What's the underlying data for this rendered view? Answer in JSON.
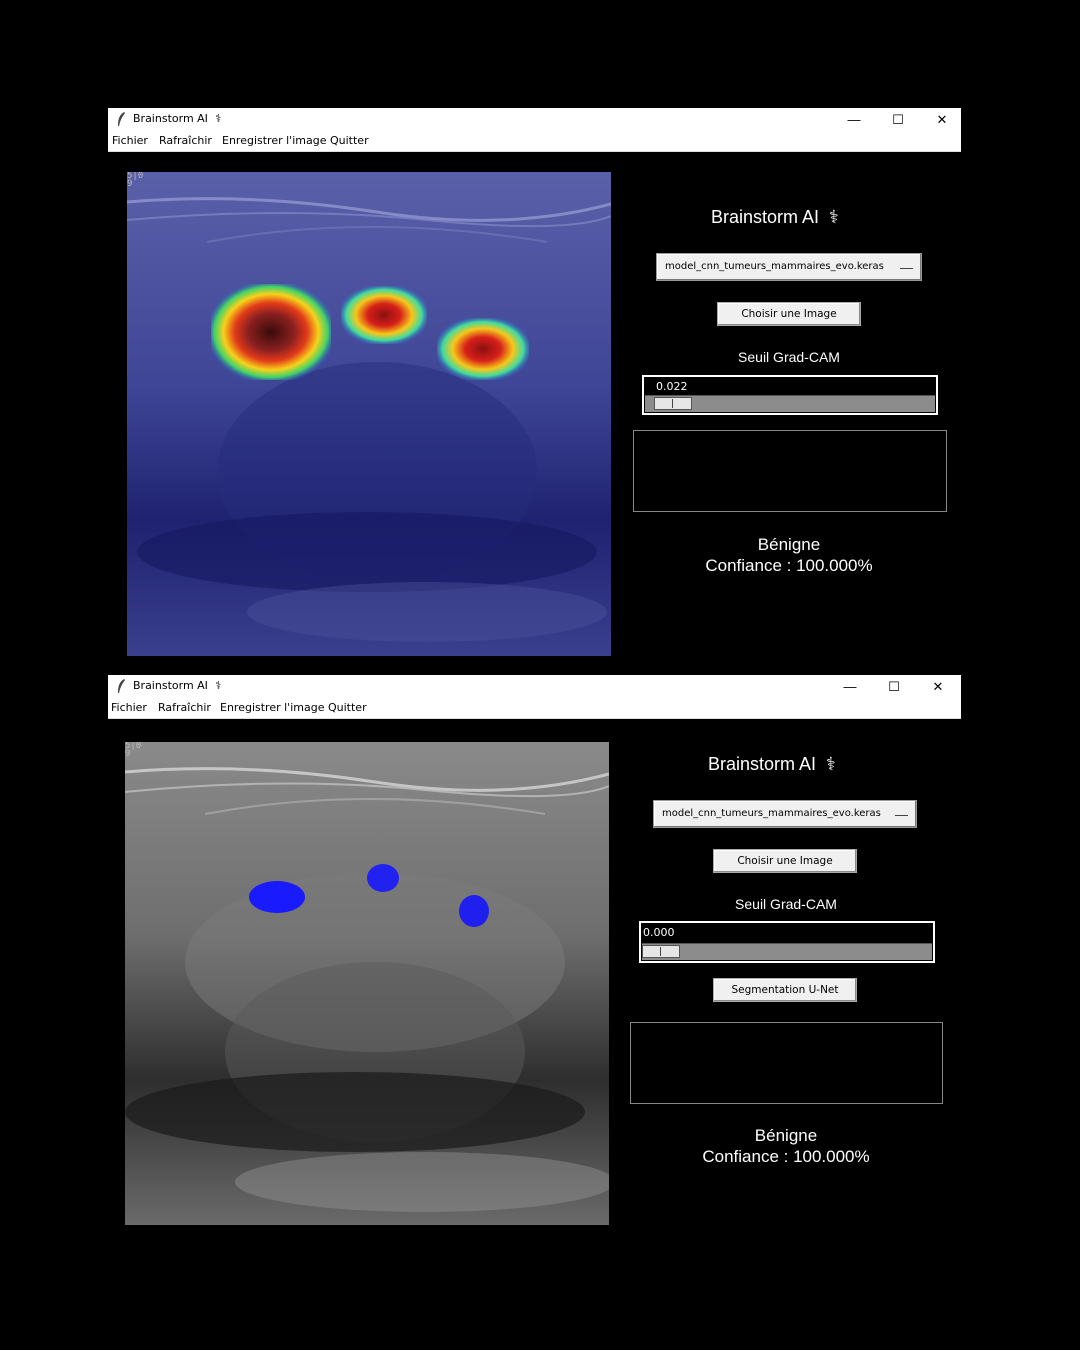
{
  "windows": [
    {
      "title": "Brainstorm AI",
      "title_icon": "caduceus-icon",
      "controls": {
        "minimize": "—",
        "maximize": "☐",
        "close": "✕"
      },
      "menu": [
        "Fichier",
        "Rafraîchir",
        "Enregistrer l'image",
        "Quitter"
      ],
      "image_corner_text": "5|0\n9",
      "app_title": "Brainstorm AI",
      "app_title_icon": "⚕",
      "model_select": {
        "selected": "model_cnn_tumeurs_mammaires_evo.keras"
      },
      "choose_image_button": "Choisir une Image",
      "threshold_label": "Seuil Grad-CAM",
      "threshold_value": "0.022",
      "threshold_fraction": 0.022,
      "result_class": "Bénigne",
      "confidence": "Confiance : 100.000%",
      "overlay": "grad-cam heatmap"
    },
    {
      "title": "Brainstorm AI",
      "title_icon": "caduceus-icon",
      "controls": {
        "minimize": "—",
        "maximize": "☐",
        "close": "✕"
      },
      "menu": [
        "Fichier",
        "Rafraîchir",
        "Enregistrer l'image",
        "Quitter"
      ],
      "image_corner_text": "5|0\n9",
      "app_title": "Brainstorm AI",
      "app_title_icon": "⚕",
      "model_select": {
        "selected": "model_cnn_tumeurs_mammaires_evo.keras"
      },
      "choose_image_button": "Choisir une Image",
      "threshold_label": "Seuil Grad-CAM",
      "threshold_value": "0.000",
      "threshold_fraction": 0.0,
      "segmentation_button": "Segmentation U-Net",
      "result_class": "Bénigne",
      "confidence": "Confiance : 100.000%",
      "overlay": "u-net segmentation mask"
    }
  ]
}
